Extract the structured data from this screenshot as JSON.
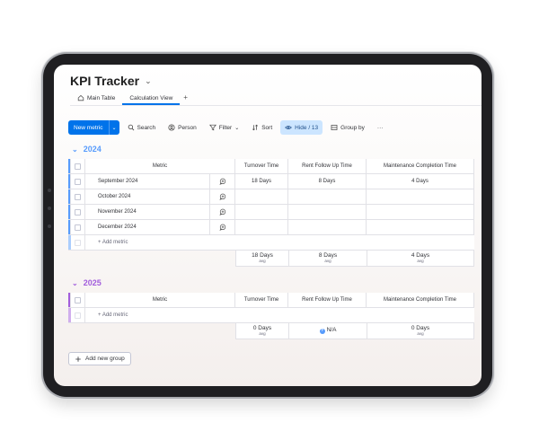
{
  "app": {
    "title": "KPI Tracker",
    "tabs": [
      {
        "label": "Main Table"
      },
      {
        "label": "Calculation View"
      }
    ],
    "add_tab": "+"
  },
  "toolbar": {
    "new_button": "New metric",
    "search": "Search",
    "person": "Person",
    "filter": "Filter",
    "sort": "Sort",
    "hide": "Hide / 13",
    "group_by": "Group by",
    "more": "···"
  },
  "columns": {
    "metric": "Metric",
    "turnover": "Turnover Time",
    "rent": "Rent Follow Up Time",
    "maintenance": "Maintenance Completion Time"
  },
  "groups": [
    {
      "name": "2024",
      "color": "#579bfc",
      "rows": [
        {
          "metric": "September 2024",
          "turnover": "18 Days",
          "rent": "8 Days",
          "maintenance": "4 Days"
        },
        {
          "metric": "October 2024",
          "turnover": "",
          "rent": "",
          "maintenance": ""
        },
        {
          "metric": "November 2024",
          "turnover": "",
          "rent": "",
          "maintenance": ""
        },
        {
          "metric": "December 2024",
          "turnover": "",
          "rent": "",
          "maintenance": ""
        }
      ],
      "add_label": "+ Add metric",
      "summary": {
        "turnover": "18 Days",
        "rent": "8 Days",
        "maintenance": "4 Days",
        "agg": "avg"
      }
    },
    {
      "name": "2025",
      "color": "#a25ddc",
      "add_label": "+ Add metric",
      "summary": {
        "turnover": "0 Days",
        "rent": "N/A",
        "maintenance": "0 Days",
        "agg": "avg"
      }
    }
  ],
  "add_group": "Add new group",
  "icons": {
    "home": "home-icon",
    "search": "search-icon",
    "person": "person-icon",
    "filter": "filter-icon",
    "sort": "sort-icon",
    "hide": "eye-icon",
    "group_by": "group-icon",
    "conversation": "conversation-icon",
    "plus": "plus-icon"
  }
}
